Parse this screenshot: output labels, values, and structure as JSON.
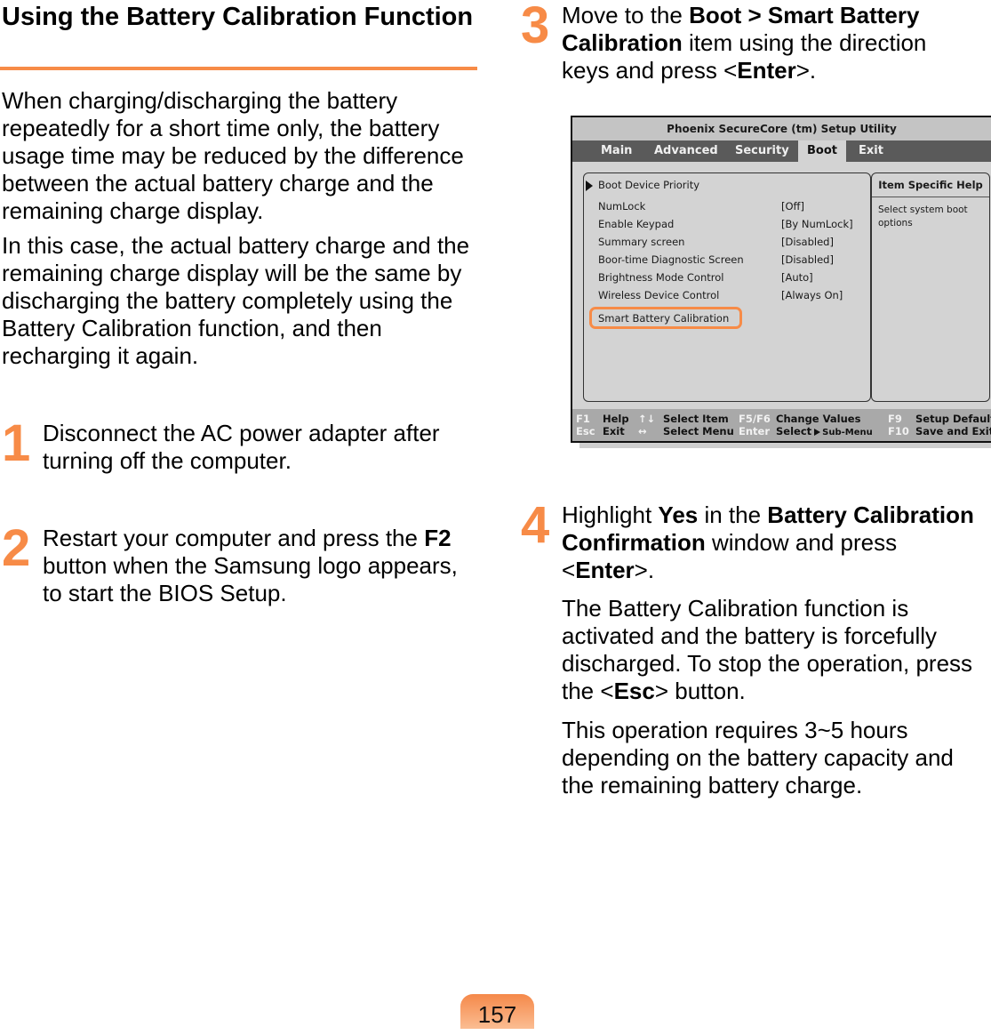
{
  "section": {
    "title": "Using the Battery Calibration Function",
    "paragraphs": [
      "When charging/discharging the battery repeatedly for a short time only, the battery usage time may be reduced by the difference between the actual battery charge and the remaining charge display.",
      "In this case, the actual battery charge and the remaining charge display will be the same by discharging the battery completely using the Battery Calibration function, and then recharging it again."
    ]
  },
  "steps": [
    {
      "number": "1",
      "text": "Disconnect the AC power adapter after turning off the computer."
    },
    {
      "number": "2",
      "bold_1": "F2",
      "text_after": " button when the Samsung logo appears, to start the BIOS Setup.",
      "text_before": "Restart your computer and press the "
    },
    {
      "number": "3",
      "text_1": "Move to the ",
      "bold_1": "Boot > Smart Battery Calibration",
      "text_2": " item using the direction keys and press <",
      "bold_2": "Enter",
      "text_3": ">."
    },
    {
      "number": "4",
      "text_1": "Highlight ",
      "bold_1": "Yes",
      "text_2": " in the ",
      "bold_2": "Battery Calibration Confirmation",
      "text_3": " window and press <",
      "bold_3": "Enter",
      "text_4": ">.",
      "note_1_before": "The Battery Calibration function is activated and the battery is forcefully discharged. To stop the operation, press the <",
      "note_1_bold": "Esc",
      "note_1_after": "> button.",
      "note_2": "This operation requires 3~5 hours depending on the battery capacity and the remaining battery charge."
    }
  ],
  "bios": {
    "title": "Phoenix SecureCore (tm) Setup Utility",
    "tabs": [
      "Main",
      "Advanced",
      "Security",
      "Boot",
      "Exit"
    ],
    "active_tab": "Boot",
    "submenu_item": "Boot Device Priority",
    "settings": [
      {
        "label": "NumLock",
        "value": "[Off]"
      },
      {
        "label": "Enable Keypad",
        "value": "[By NumLock]"
      },
      {
        "label": "Summary screen",
        "value": "[Disabled]"
      },
      {
        "label": "Boor-time Diagnostic Screen",
        "value": "[Disabled]"
      },
      {
        "label": "Brightness Mode Control",
        "value": "[Auto]"
      },
      {
        "label": "Wireless Device Control",
        "value": "[Always On]"
      }
    ],
    "highlighted_item": "Smart Battery Calibration",
    "help_header": "Item Specific Help",
    "help_text": "Select system boot options",
    "footer": {
      "row1": [
        {
          "key": "F1",
          "label": "Help"
        },
        {
          "key": "↑↓",
          "label": "Select Item"
        },
        {
          "key": "F5/F6",
          "label": "Change Values"
        },
        {
          "key": "F9",
          "label": "Setup Defaults"
        }
      ],
      "row2": [
        {
          "key": "Esc",
          "label": "Exit"
        },
        {
          "key": "↔",
          "label": "Select Menu"
        },
        {
          "key": "Enter",
          "label": "Select",
          "suffix": "Sub-Menu"
        },
        {
          "key": "F10",
          "label": "Save and Exit"
        }
      ]
    }
  },
  "page_number": "157",
  "colors": {
    "accent": "#f78b47",
    "bios_bg": "#d3d3d3",
    "bios_menubar": "#5a5a5a",
    "bios_footer": "#a9a9a9"
  }
}
